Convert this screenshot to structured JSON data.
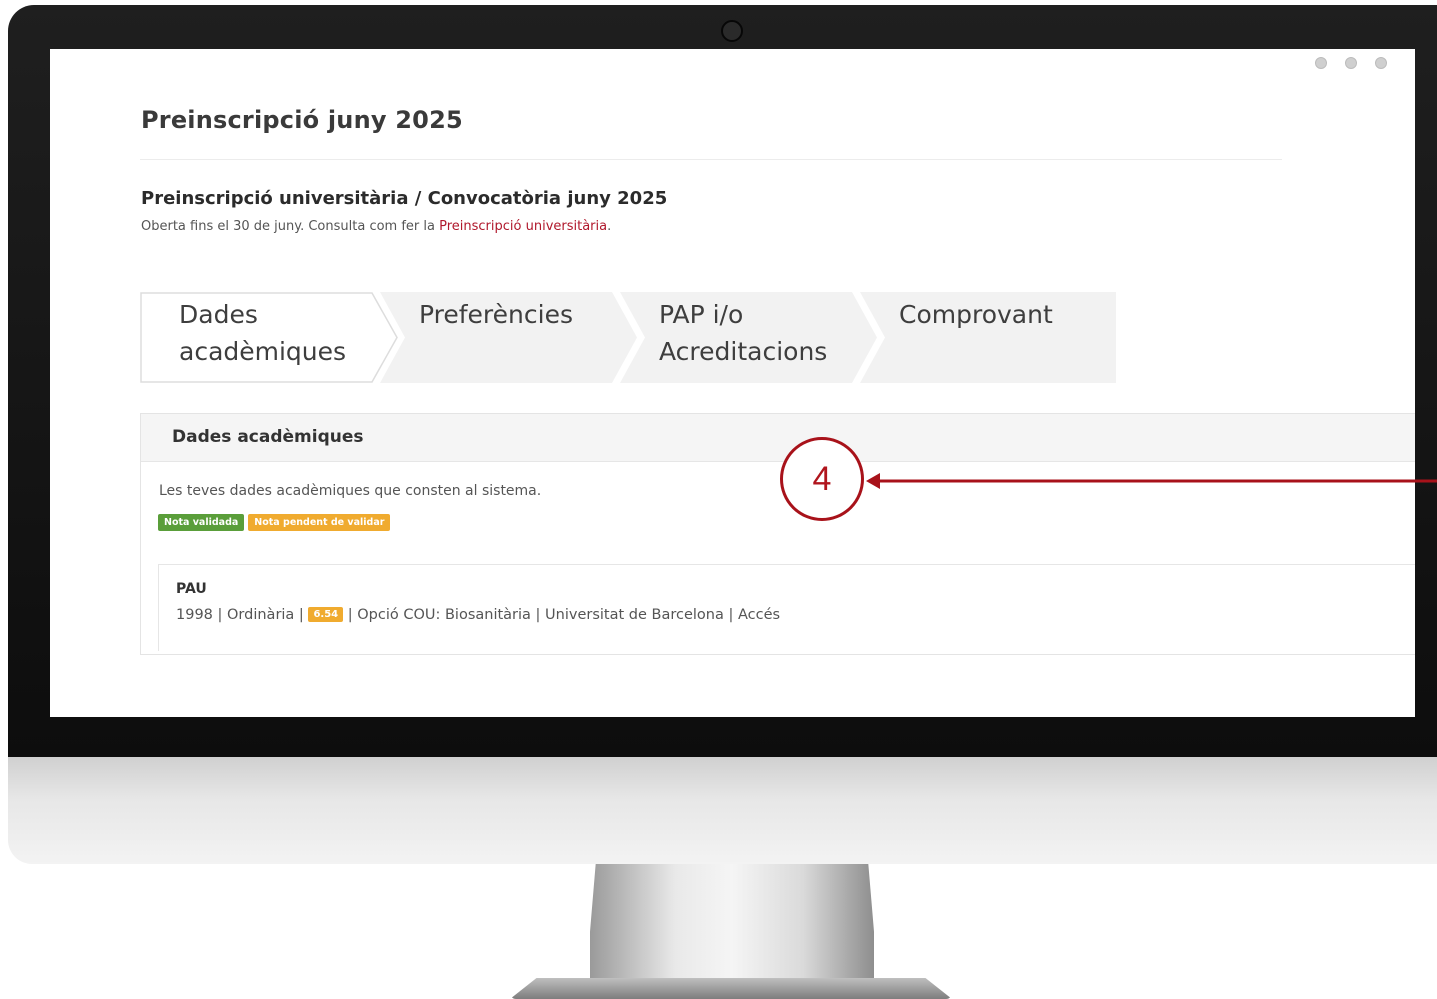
{
  "header": {
    "title": "Preinscripció juny 2025"
  },
  "section": {
    "title": "Preinscripció universitària / Convocatòria juny 2025",
    "subtitle_prefix": "Oberta fins el 30 de juny. Consulta com fer la ",
    "subtitle_link": "Preinscripció universitària",
    "subtitle_suffix": "."
  },
  "steps": [
    {
      "label": "Dades acadèmiques",
      "active": true
    },
    {
      "label": "Preferències",
      "active": false
    },
    {
      "label": "PAP i/o Acreditacions",
      "active": false
    },
    {
      "label": "Comprovant",
      "active": false
    }
  ],
  "panel": {
    "title": "Dades acadèmiques",
    "description": "Les teves dades acadèmiques que consten al sistema.",
    "badges": [
      {
        "label": "Nota validada",
        "color": "#5a9e3a"
      },
      {
        "label": "Nota pendent de validar",
        "color": "#f0ab2f"
      }
    ],
    "record": {
      "title": "PAU",
      "year": "1998",
      "call": "Ordinària",
      "grade": "6.54",
      "option": "Opció COU: Biosanitària",
      "university": "Universitat de Barcelona",
      "access": "Accés",
      "separator": " | "
    }
  },
  "annotation": {
    "number": "4",
    "color": "#a8121a"
  },
  "colors": {
    "link": "#b0182c",
    "step_bg": "#f2f2f2",
    "active_step_bg": "#ffffff"
  }
}
